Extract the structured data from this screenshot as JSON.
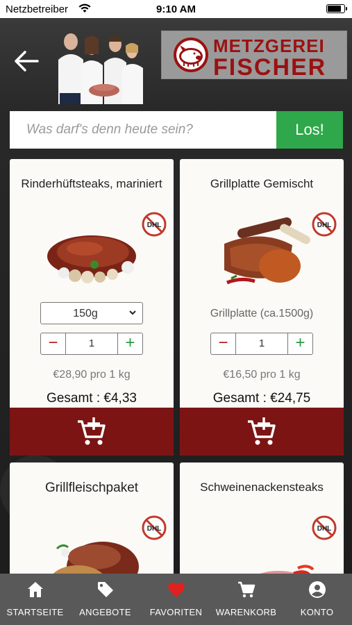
{
  "status_bar": {
    "carrier": "Netzbetreiber",
    "time": "9:10 AM",
    "battery_level": 0.85
  },
  "header": {
    "logo_line1": "METZGEREI",
    "logo_line2": "FISCHER"
  },
  "search": {
    "placeholder": "Was darf's denn heute sein?",
    "button_label": "Los!"
  },
  "products": [
    {
      "title": "Rinderhüftsteaks, mariniert",
      "selected_option": "150g",
      "quantity": "1",
      "unit_price": "€28,90 pro 1 kg",
      "total": "Gesamt : €4,33",
      "badge": "DHL"
    },
    {
      "title": "Grillplatte Gemischt",
      "variant": "Grillplatte (ca.1500g)",
      "quantity": "1",
      "unit_price": "€16,50 pro 1 kg",
      "total": "Gesamt : €24,75",
      "badge": "DHL"
    },
    {
      "title": "Grillfleischpaket",
      "badge": "DHL"
    },
    {
      "title": "Schweinenackensteaks",
      "badge": "DHL"
    }
  ],
  "tabbar": {
    "tabs": [
      {
        "label": "STARTSEITE",
        "icon": "home-icon"
      },
      {
        "label": "ANGEBOTE",
        "icon": "tag-icon"
      },
      {
        "label": "FAVORITEN",
        "icon": "heart-icon"
      },
      {
        "label": "WARENKORB",
        "icon": "cart-icon"
      },
      {
        "label": "KONTO",
        "icon": "account-icon"
      }
    ]
  },
  "colors": {
    "accent_red": "#7c1414",
    "go_green": "#2ea84a",
    "favorite_red": "#e0211f",
    "tabbar_bg": "#595959"
  }
}
